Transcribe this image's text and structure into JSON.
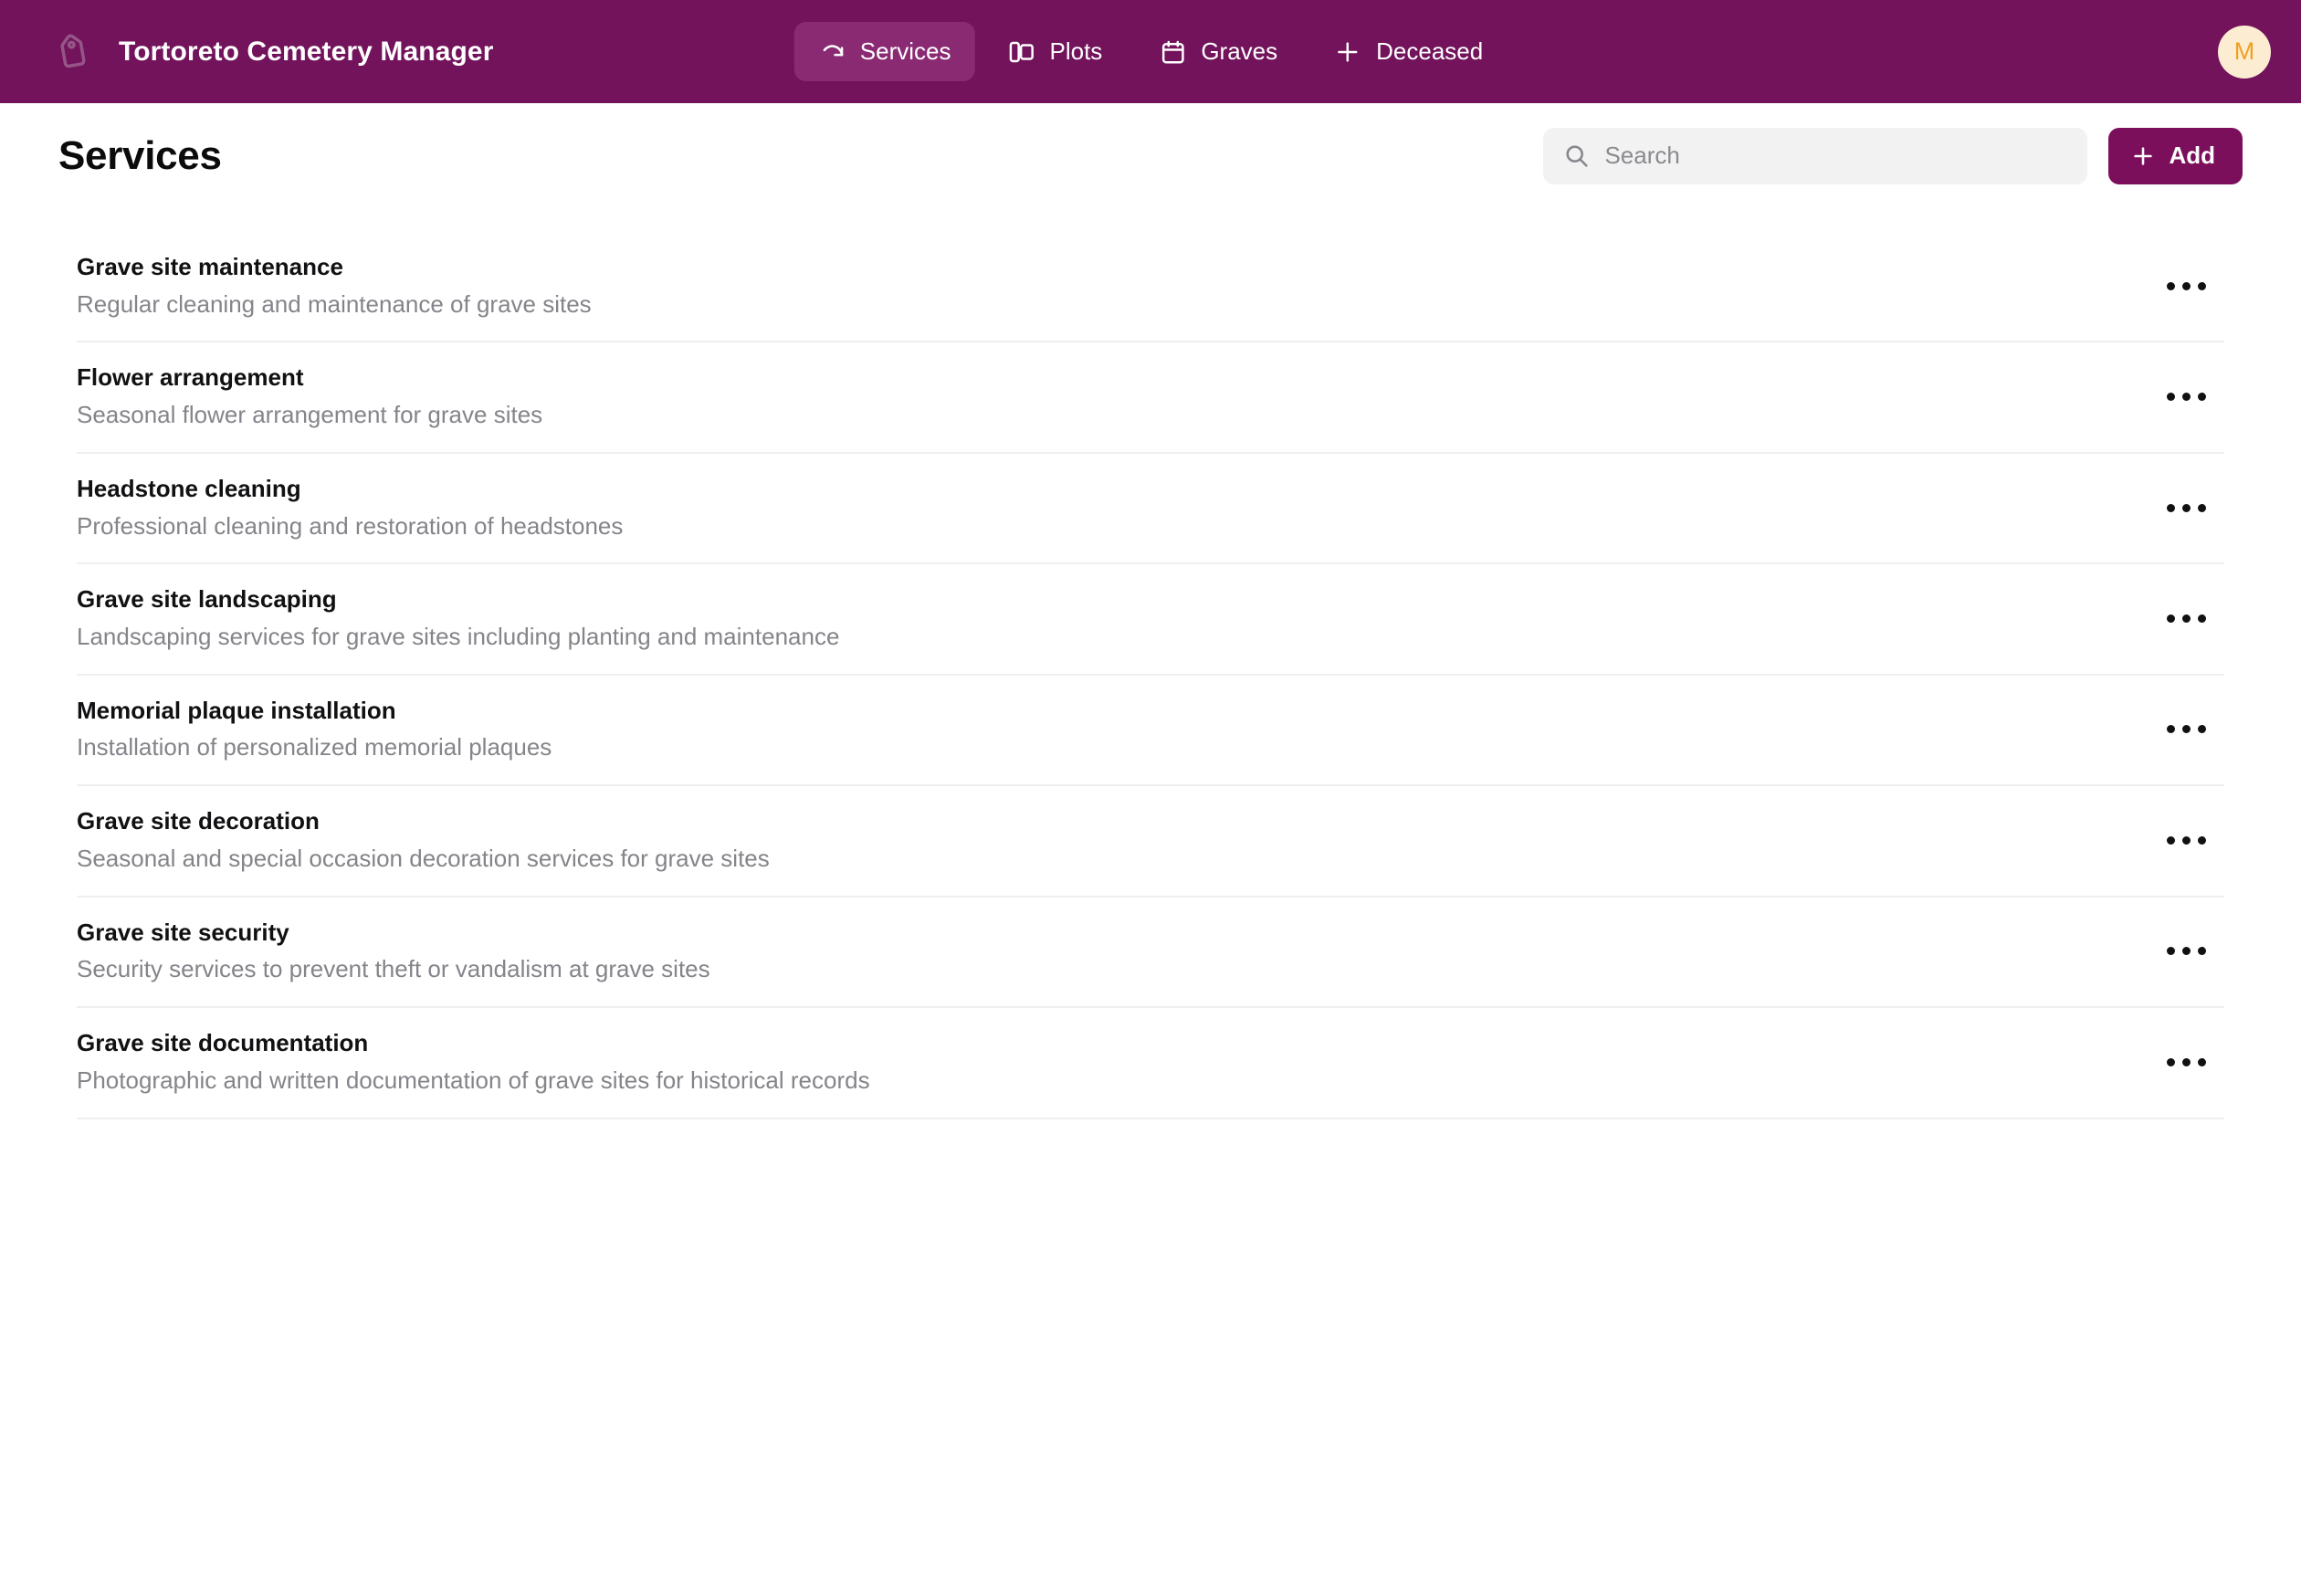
{
  "appbar": {
    "brand_icon": "tag-icon",
    "title": "Tortoreto Cemetery Manager",
    "avatar_initial": "M",
    "avatar_bg": "#FCECD2",
    "avatar_fg": "#F0A020",
    "bar_color": "#72135B",
    "active_pill_color": "#8A2A73",
    "nav": [
      {
        "label": "Services",
        "icon": "redo-arrow-icon",
        "active": true
      },
      {
        "label": "Plots",
        "icon": "panels-icon",
        "active": false
      },
      {
        "label": "Graves",
        "icon": "calendar-icon",
        "active": false
      },
      {
        "label": "Deceased",
        "icon": "plus-icon",
        "active": false
      }
    ]
  },
  "page": {
    "title": "Services",
    "search": {
      "icon": "search-icon",
      "value": "",
      "placeholder": "Search"
    },
    "add_button": {
      "icon": "plus-icon",
      "label": "Add",
      "color": "#7C0F5C"
    },
    "row_menu_icon": "ellipsis-icon",
    "services": [
      {
        "name": "Grave site maintenance",
        "description": "Regular cleaning and maintenance of grave sites"
      },
      {
        "name": "Flower arrangement",
        "description": "Seasonal flower arrangement for grave sites"
      },
      {
        "name": "Headstone cleaning",
        "description": "Professional cleaning and restoration of headstones"
      },
      {
        "name": "Grave site landscaping",
        "description": "Landscaping services for grave sites including planting and maintenance"
      },
      {
        "name": "Memorial plaque installation",
        "description": "Installation of personalized memorial plaques"
      },
      {
        "name": "Grave site decoration",
        "description": "Seasonal and special occasion decoration services for grave sites"
      },
      {
        "name": "Grave site security",
        "description": "Security services to prevent theft or vandalism at grave sites"
      },
      {
        "name": "Grave site documentation",
        "description": "Photographic and written documentation of grave sites for historical records"
      }
    ]
  }
}
